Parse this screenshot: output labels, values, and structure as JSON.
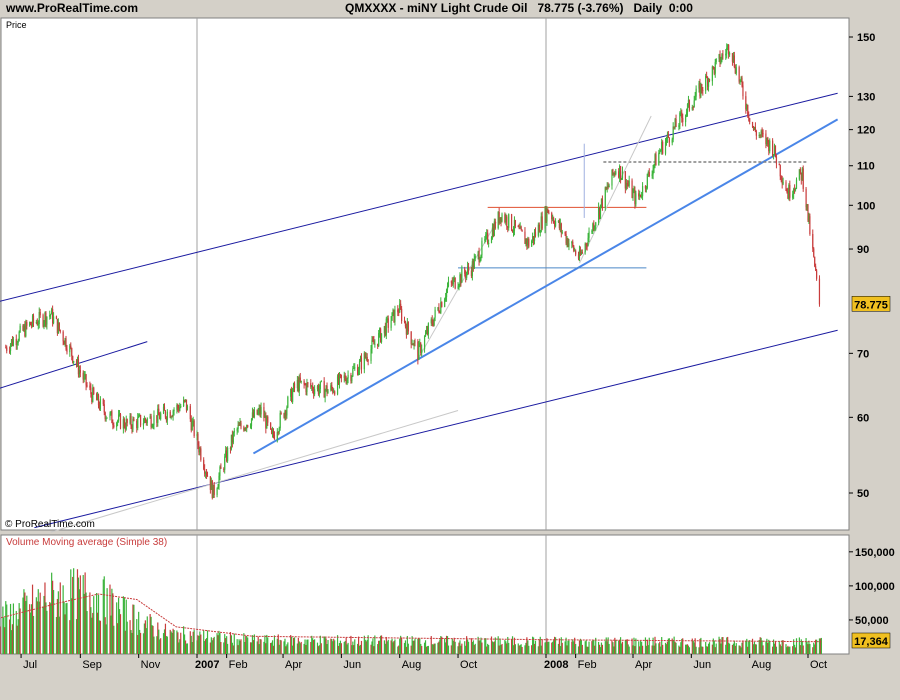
{
  "header": {
    "site": "www.ProRealTime.com",
    "title": "QMXXXX - miNY Light Crude Oil   78.775 (-3.76%)   Daily  0:00"
  },
  "colors": {
    "up": "#3cb43c",
    "down": "#c83c3c",
    "channel": "#1a1aa0",
    "trendline": "#4a86e8",
    "resistance": "#e05030",
    "support": "#4a86c8",
    "volume_ma": "#c83c3c",
    "last_price_box": "#f0c020"
  },
  "chart_data": [
    {
      "type": "candlestick",
      "panel_label": "Price",
      "copyright": "© ProRealTime.com",
      "y_scale": "log",
      "ylim": [
        45,
        157
      ],
      "y_ticks": [
        50,
        60,
        70,
        90,
        100,
        110,
        120,
        130,
        150
      ],
      "x_ticks": [
        "Jul",
        "Sep",
        "Nov",
        "2007",
        "Feb",
        "Apr",
        "Jun",
        "Aug",
        "Oct",
        "2008",
        "Feb",
        "Apr",
        "Jun",
        "Aug",
        "Oct"
      ],
      "last_price": "78.775",
      "price_path": [
        {
          "date": "2006-06-15",
          "close": 71
        },
        {
          "date": "2006-07-10",
          "close": 75
        },
        {
          "date": "2006-08-01",
          "close": 77
        },
        {
          "date": "2006-08-20",
          "close": 71
        },
        {
          "date": "2006-09-10",
          "close": 64
        },
        {
          "date": "2006-10-01",
          "close": 60
        },
        {
          "date": "2006-10-20",
          "close": 59
        },
        {
          "date": "2006-11-20",
          "close": 60
        },
        {
          "date": "2006-12-20",
          "close": 62
        },
        {
          "date": "2007-01-18",
          "close": 50
        },
        {
          "date": "2007-02-10",
          "close": 58
        },
        {
          "date": "2007-03-10",
          "close": 61
        },
        {
          "date": "2007-03-20",
          "close": 57
        },
        {
          "date": "2007-04-15",
          "close": 65
        },
        {
          "date": "2007-05-20",
          "close": 64
        },
        {
          "date": "2007-06-20",
          "close": 68
        },
        {
          "date": "2007-07-31",
          "close": 78
        },
        {
          "date": "2007-08-20",
          "close": 70
        },
        {
          "date": "2007-09-20",
          "close": 82
        },
        {
          "date": "2007-10-15",
          "close": 86
        },
        {
          "date": "2007-11-15",
          "close": 98
        },
        {
          "date": "2007-12-15",
          "close": 91
        },
        {
          "date": "2008-01-03",
          "close": 99
        },
        {
          "date": "2008-02-05",
          "close": 88
        },
        {
          "date": "2008-03-15",
          "close": 110
        },
        {
          "date": "2008-04-05",
          "close": 101
        },
        {
          "date": "2008-05-01",
          "close": 115
        },
        {
          "date": "2008-06-01",
          "close": 128
        },
        {
          "date": "2008-07-11",
          "close": 147
        },
        {
          "date": "2008-08-05",
          "close": 120
        },
        {
          "date": "2008-08-25",
          "close": 115
        },
        {
          "date": "2008-09-10",
          "close": 103
        },
        {
          "date": "2008-09-25",
          "close": 108
        },
        {
          "date": "2008-10-13",
          "close": 78.775
        }
      ],
      "annotations": [
        {
          "kind": "channel_upper",
          "points": [
            [
              "2006-06-01",
              79
            ],
            [
              "2008-11-01",
              131
            ]
          ]
        },
        {
          "kind": "channel_lower",
          "points": [
            [
              "2006-07-15",
              46
            ],
            [
              "2008-11-01",
              74
            ]
          ]
        },
        {
          "kind": "channel_left",
          "points": [
            [
              "2006-06-01",
              64
            ],
            [
              "2006-11-10",
              72
            ]
          ]
        },
        {
          "kind": "trendline",
          "points": [
            [
              "2007-03-01",
              55
            ],
            [
              "2008-11-01",
              123
            ]
          ]
        },
        {
          "kind": "resistance",
          "points": [
            [
              "2007-11-01",
              99.5
            ],
            [
              "2008-04-15",
              99.5
            ]
          ]
        },
        {
          "kind": "support",
          "points": [
            [
              "2007-10-01",
              86
            ],
            [
              "2008-04-15",
              86
            ]
          ]
        },
        {
          "kind": "breakout_level",
          "points": [
            [
              "2008-03-01",
              111
            ],
            [
              "2008-09-30",
              111
            ]
          ]
        },
        {
          "kind": "measured_move",
          "points": [
            [
              "2008-02-10",
              97
            ],
            [
              "2008-02-10",
              116
            ]
          ]
        }
      ]
    },
    {
      "type": "bar",
      "panel_label": "Volume Moving average (Simple 38)",
      "ylim": [
        0,
        160000
      ],
      "y_ticks": [
        50000,
        100000,
        150000
      ],
      "y_tick_labels": [
        "50,000",
        "100,000",
        "150,000"
      ],
      "last_value": "17,364",
      "volume_profile": [
        {
          "date": "2006-06-01",
          "volume": 45000
        },
        {
          "date": "2006-08-01",
          "volume": 85000
        },
        {
          "date": "2006-09-15",
          "volume": 90000
        },
        {
          "date": "2006-10-15",
          "volume": 60000
        },
        {
          "date": "2006-12-01",
          "volume": 30000
        },
        {
          "date": "2007-03-01",
          "volume": 20000
        },
        {
          "date": "2008-01-01",
          "volume": 18000
        },
        {
          "date": "2008-10-15",
          "volume": 17364
        }
      ],
      "ma_path": [
        {
          "date": "2006-06-01",
          "value": 50000
        },
        {
          "date": "2006-08-10",
          "value": 75000
        },
        {
          "date": "2006-09-20",
          "value": 88000
        },
        {
          "date": "2006-10-30",
          "value": 80000
        },
        {
          "date": "2006-12-10",
          "value": 40000
        },
        {
          "date": "2007-03-01",
          "value": 26000
        },
        {
          "date": "2008-01-01",
          "value": 21000
        },
        {
          "date": "2008-10-15",
          "value": 18000
        }
      ]
    }
  ]
}
